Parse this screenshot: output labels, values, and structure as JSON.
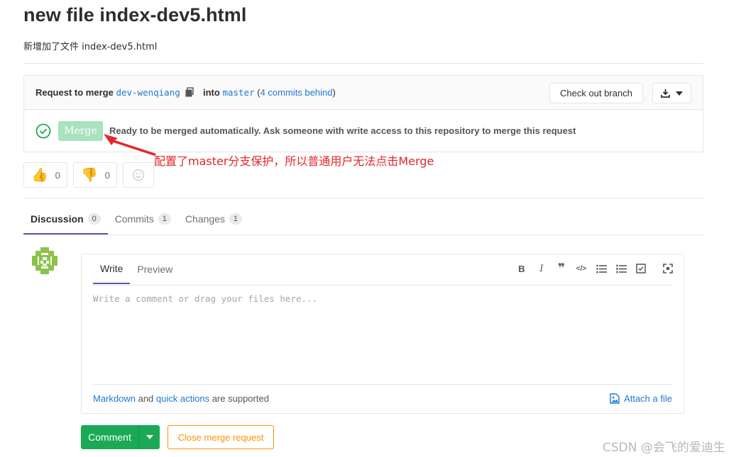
{
  "page": {
    "title": "new file index-dev5.html",
    "description": "新增加了文件 index-dev5.html"
  },
  "merge_request": {
    "prefix": "Request to merge",
    "source_branch": "dev-wenqiang",
    "into": "into",
    "target_branch": "master",
    "behind_open": "(",
    "behind_link": "4 commits behind",
    "behind_close": ")",
    "checkout_label": "Check out branch",
    "merge_label": "Merge",
    "status_text": "Ready to be merged automatically. Ask someone with write access to this repository to merge this request"
  },
  "annotation": {
    "text": "配置了master分支保护，所以普通用户无法点击Merge",
    "color": "#e3262b"
  },
  "awards": {
    "thumbsup_count": "0",
    "thumbsdown_count": "0"
  },
  "tabs": [
    {
      "label": "Discussion",
      "count": "0"
    },
    {
      "label": "Commits",
      "count": "1"
    },
    {
      "label": "Changes",
      "count": "1"
    }
  ],
  "editor": {
    "write_tab": "Write",
    "preview_tab": "Preview",
    "placeholder": "Write a comment or drag your files here...",
    "footer_markdown": "Markdown",
    "footer_and": "and",
    "footer_quick": "quick actions",
    "footer_supported": "are supported",
    "attach_label": "Attach a file",
    "toolbar_icons": [
      "bold-icon",
      "italic-icon",
      "quote-icon",
      "code-icon",
      "bullet-list-icon",
      "numbered-list-icon",
      "task-list-icon",
      "fullscreen-icon"
    ]
  },
  "actions": {
    "comment_label": "Comment",
    "close_label": "Close merge request"
  },
  "watermark": "CSDN @会飞的爱迪生",
  "colors": {
    "accent": "#1f78d1",
    "success": "#1aaa55",
    "merge_disabled": "#a8e2be",
    "warning": "#fc9403",
    "tab_active": "#6b4fbb"
  }
}
